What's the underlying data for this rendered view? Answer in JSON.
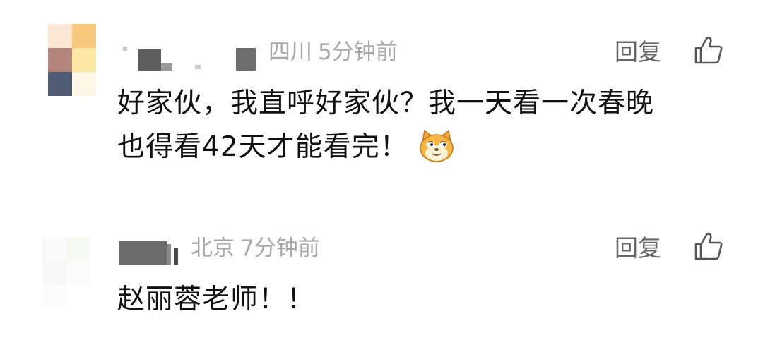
{
  "comments": [
    {
      "location": "四川",
      "time": "5分钟前",
      "reply_label": "回复",
      "text_line1": "好家伙，我直呼好家伙？我一天看一次春晚",
      "text_line2": "也得看42天才能看完！",
      "emoji": "doge-cat-emoji",
      "avatar_colors": [
        "#fce7d4",
        "#f7c97c",
        "#b4857d",
        "#fce7a4",
        "#4f5a73",
        "#fef7e6"
      ]
    },
    {
      "location": "北京",
      "time": "7分钟前",
      "reply_label": "回复",
      "text": "赵丽蓉老师！！",
      "avatar_colors": [
        "#fafafa",
        "#f8fbf1",
        "#f7f7f7",
        "#fbfbfb",
        "#fcfcfc",
        "#fefefe"
      ]
    }
  ],
  "icons": {
    "like": "thumbs-up-icon"
  },
  "colors": {
    "meta": "#a9a9a9",
    "text": "#111111",
    "action": "#666666"
  }
}
